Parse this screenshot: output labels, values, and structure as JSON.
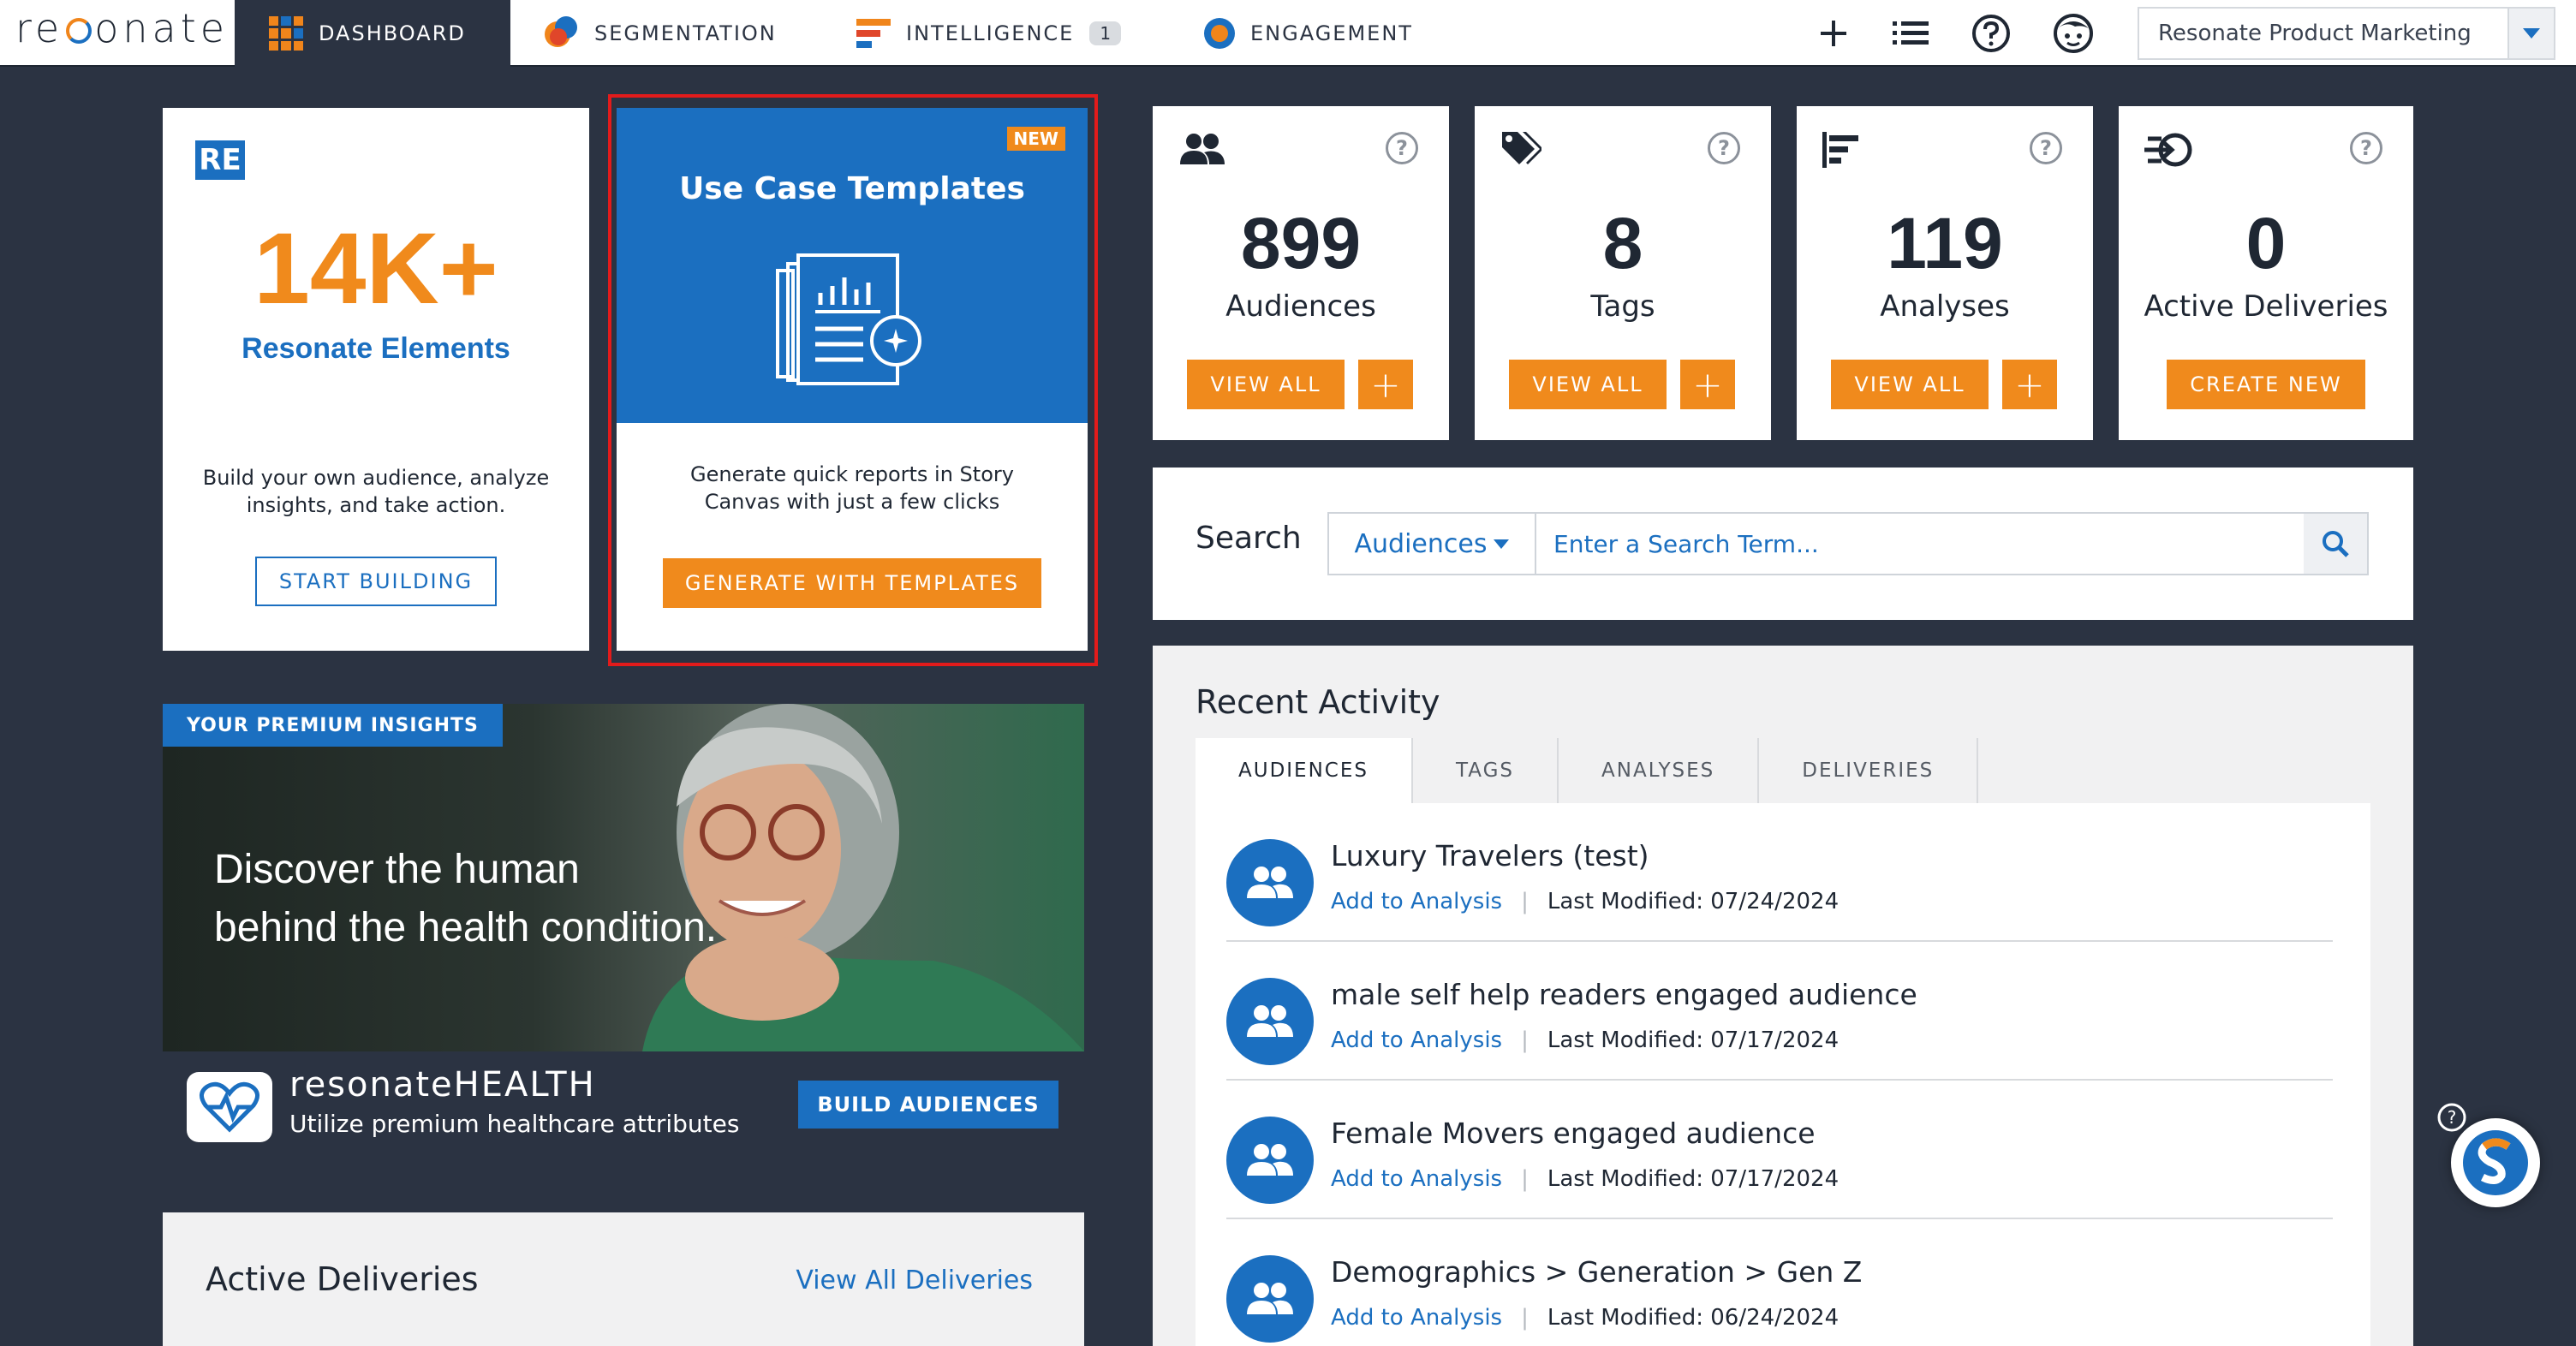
{
  "app": {
    "logo_text": "resonate"
  },
  "nav": {
    "tabs": [
      {
        "label": "DASHBOARD",
        "icon": "dashboard-grid-icon"
      },
      {
        "label": "SEGMENTATION",
        "icon": "segmentation-icon"
      },
      {
        "label": "INTELLIGENCE",
        "icon": "intelligence-icon",
        "badge": "1"
      },
      {
        "label": "ENGAGEMENT",
        "icon": "engagement-icon"
      }
    ],
    "icons": [
      "plus-icon",
      "list-icon",
      "help-icon",
      "user-face-icon"
    ],
    "account": "Resonate Product Marketing"
  },
  "elements_card": {
    "logo": "RE",
    "number": "14K+",
    "title": "Resonate Elements",
    "description": "Build your own audience, analyze insights, and take action.",
    "button": "START BUILDING"
  },
  "templates_card": {
    "badge": "NEW",
    "title": "Use Case Templates",
    "description": "Generate quick reports in Story Canvas with just a few clicks",
    "button": "GENERATE WITH TEMPLATES"
  },
  "stats": [
    {
      "icon": "people-icon",
      "value": "899",
      "label": "Audiences",
      "button": "VIEW ALL",
      "plus": "+"
    },
    {
      "icon": "tags-icon",
      "value": "8",
      "label": "Tags",
      "button": "VIEW ALL",
      "plus": "+"
    },
    {
      "icon": "analyses-icon",
      "value": "119",
      "label": "Analyses",
      "button": "VIEW ALL",
      "plus": "+"
    },
    {
      "icon": "deliveries-icon",
      "value": "0",
      "label": "Active Deliveries",
      "button": "CREATE NEW"
    }
  ],
  "search": {
    "label": "Search",
    "category": "Audiences",
    "placeholder": "Enter a Search Term..."
  },
  "promo": {
    "tag": "YOUR PREMIUM INSIGHTS",
    "headline_1": "Discover the human",
    "headline_2": "behind the health condition.",
    "brand": "resonateHEALTH",
    "subtitle": "Utilize premium healthcare attributes",
    "button": "BUILD AUDIENCES"
  },
  "deliveries": {
    "title": "Active Deliveries",
    "link": "View All Deliveries"
  },
  "recent": {
    "title": "Recent Activity",
    "tabs": [
      "AUDIENCES",
      "TAGS",
      "ANALYSES",
      "DELIVERIES"
    ],
    "items": [
      {
        "name": "Luxury Travelers (test)",
        "action": "Add to Analysis",
        "modified": "Last Modified: 07/24/2024"
      },
      {
        "name": "male self help readers engaged audience",
        "action": "Add to Analysis",
        "modified": "Last Modified: 07/17/2024"
      },
      {
        "name": "Female Movers engaged audience",
        "action": "Add to Analysis",
        "modified": "Last Modified: 07/17/2024"
      },
      {
        "name": "Demographics > Generation > Gen Z",
        "action": "Add to Analysis",
        "modified": "Last Modified: 06/24/2024"
      }
    ]
  },
  "colors": {
    "brand_blue": "#1b6fc0",
    "brand_orange": "#f08a1c",
    "background": "#2b3342",
    "highlight": "#e21b1b"
  }
}
